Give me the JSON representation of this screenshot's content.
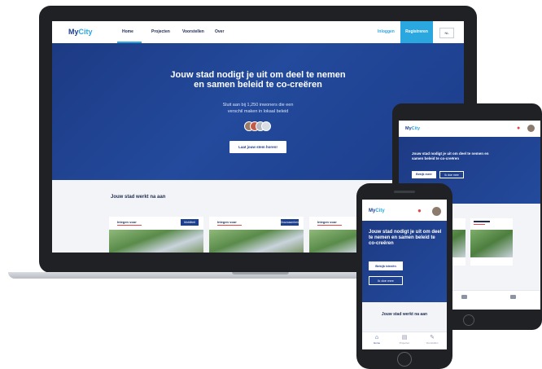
{
  "brand": {
    "prefix": "My",
    "accent": "City",
    "primary_color": "#1d3f8f",
    "accent_color": "#2aa7df"
  },
  "laptop": {
    "nav": {
      "items": [
        "Home",
        "Projecten",
        "Voorstellen",
        "Over"
      ],
      "login": "Inloggen",
      "register": "Registreren",
      "language": "NL"
    },
    "hero": {
      "title_line1": "Jouw stad nodigt je uit om deel te nemen",
      "title_line2": "en samen beleid te co-creëren",
      "subtitle_line1": "Sluit aan bij 1,250 inwoners die een",
      "subtitle_line2": "verschil maken in lokaal beleid",
      "cta": "Laat jouw stem horen!"
    },
    "section_title": "Jouw stad werkt na aan",
    "cards": [
      {
        "label": "Inlegen voor",
        "badge": "Mobiliteit"
      },
      {
        "label": "Inlegen voor",
        "badge": "Duurzaamheid"
      },
      {
        "label": "Inlegen voor",
        "badge": ""
      }
    ]
  },
  "tablet": {
    "hero_title": "Jouw stad nodigt je uit om deel te nemen en samen beleid te co-creëren",
    "btn_primary": "Bekijk meer",
    "btn_secondary": "Ik doe mee"
  },
  "phone": {
    "hero_title": "Jouw stad nodigt je uit om deel te nemen en samen beleid te co-creëren",
    "btn_primary": "Bekijk ideeën",
    "btn_secondary": "Ik doe mee",
    "section_title": "Jouw stad werkt na aan",
    "tabs": [
      {
        "label": "Home",
        "icon": "home-icon"
      },
      {
        "label": "Projecten",
        "icon": "folder-icon"
      },
      {
        "label": "Voorstellen",
        "icon": "idea-icon"
      }
    ]
  }
}
